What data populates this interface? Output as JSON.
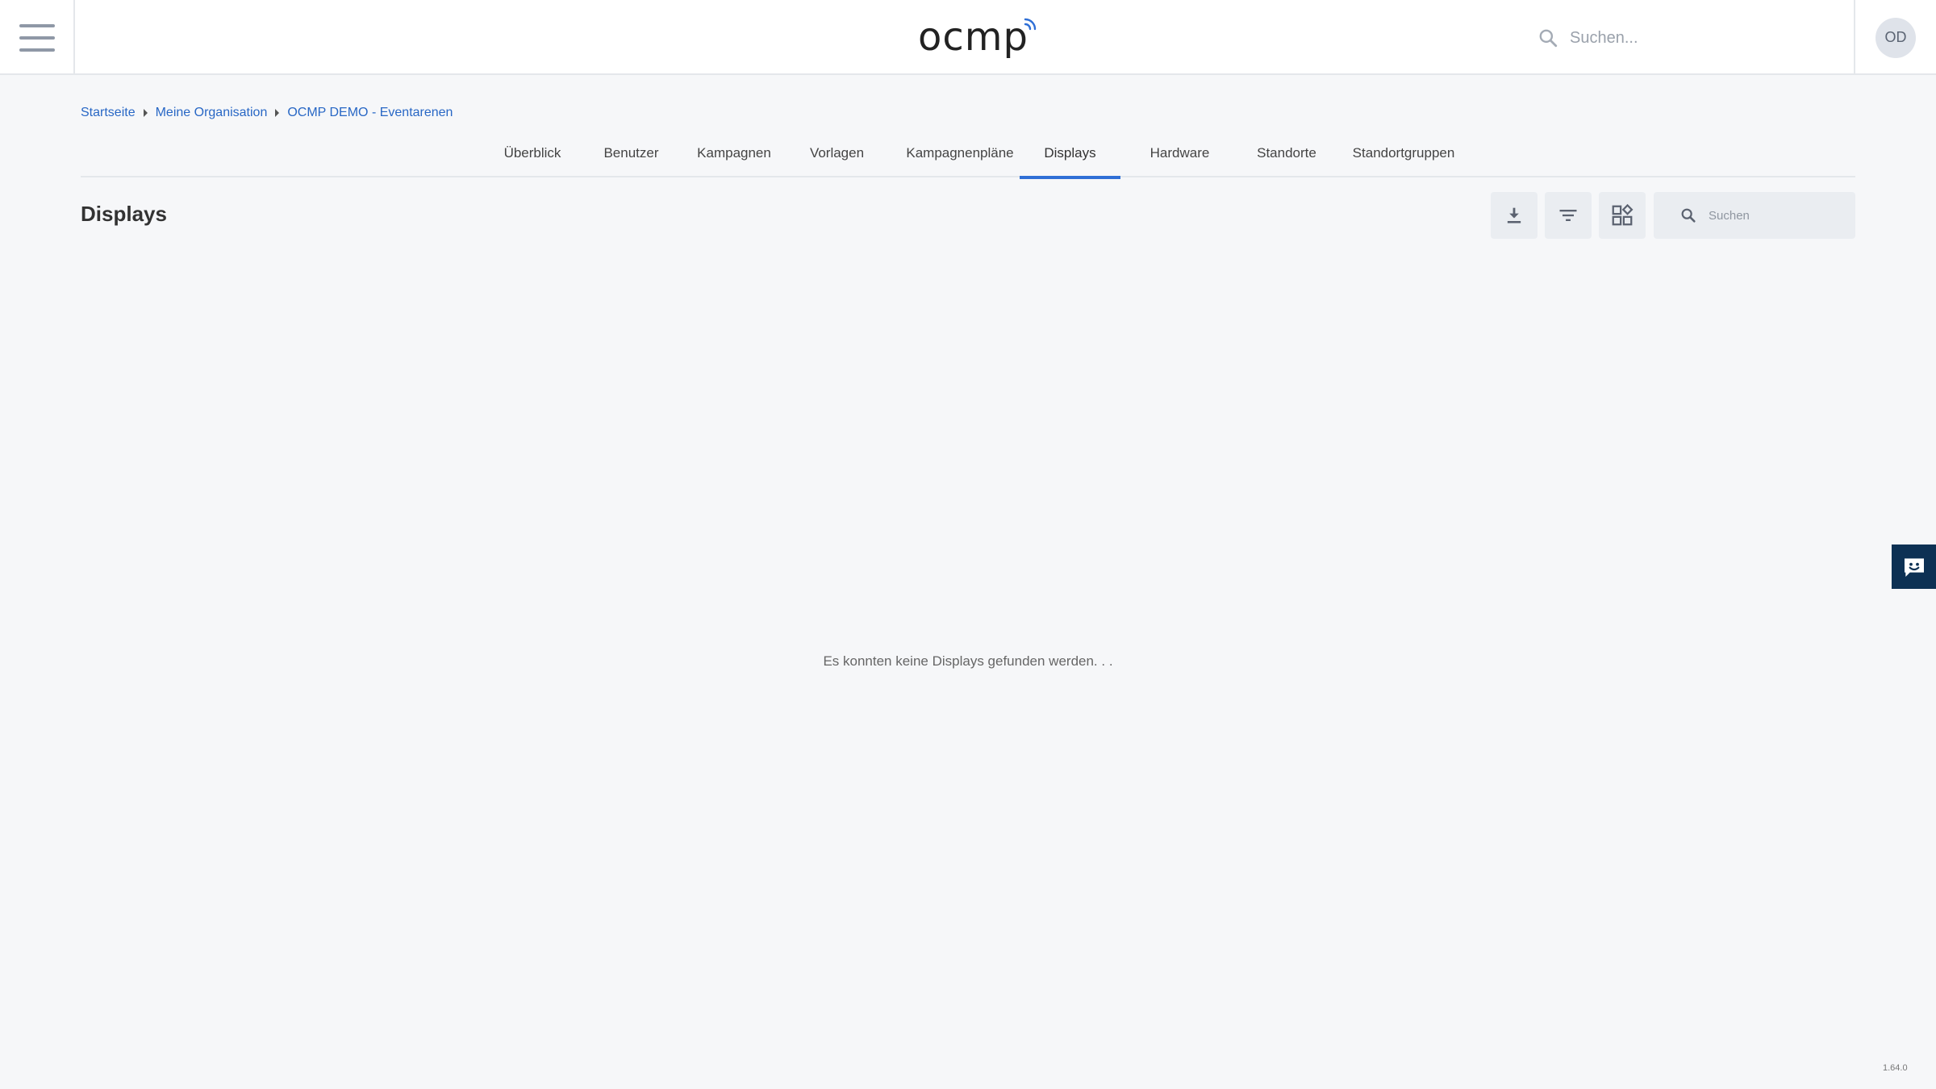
{
  "header": {
    "logo_text": "ocmp",
    "search_placeholder": "Suchen...",
    "avatar_initials": "OD"
  },
  "breadcrumb": [
    {
      "label": "Startseite"
    },
    {
      "label": "Meine Organisation"
    },
    {
      "label": "OCMP DEMO - Eventarenen"
    }
  ],
  "tabs": [
    {
      "label": "Überblick"
    },
    {
      "label": "Benutzer"
    },
    {
      "label": "Kampagnen"
    },
    {
      "label": "Vorlagen"
    },
    {
      "label": "Kampagnenpläne"
    },
    {
      "label": "Displays",
      "active": true
    },
    {
      "label": "Hardware"
    },
    {
      "label": "Standorte"
    },
    {
      "label": "Standortgruppen"
    }
  ],
  "page": {
    "title": "Displays",
    "search_placeholder": "Suchen",
    "empty_message": "Es konnten keine Displays gefunden werden. . ."
  },
  "toolbar": {
    "download_icon": "download-icon",
    "filter_icon": "filter-icon",
    "view_icon": "grid-view-icon"
  },
  "feedback_icon": "chat-smile-icon",
  "version": "1.64.0",
  "colors": {
    "accent": "#2f6fd6",
    "link": "#2867c5",
    "feedback_bg": "#0d3154",
    "background": "#f6f7f9"
  }
}
